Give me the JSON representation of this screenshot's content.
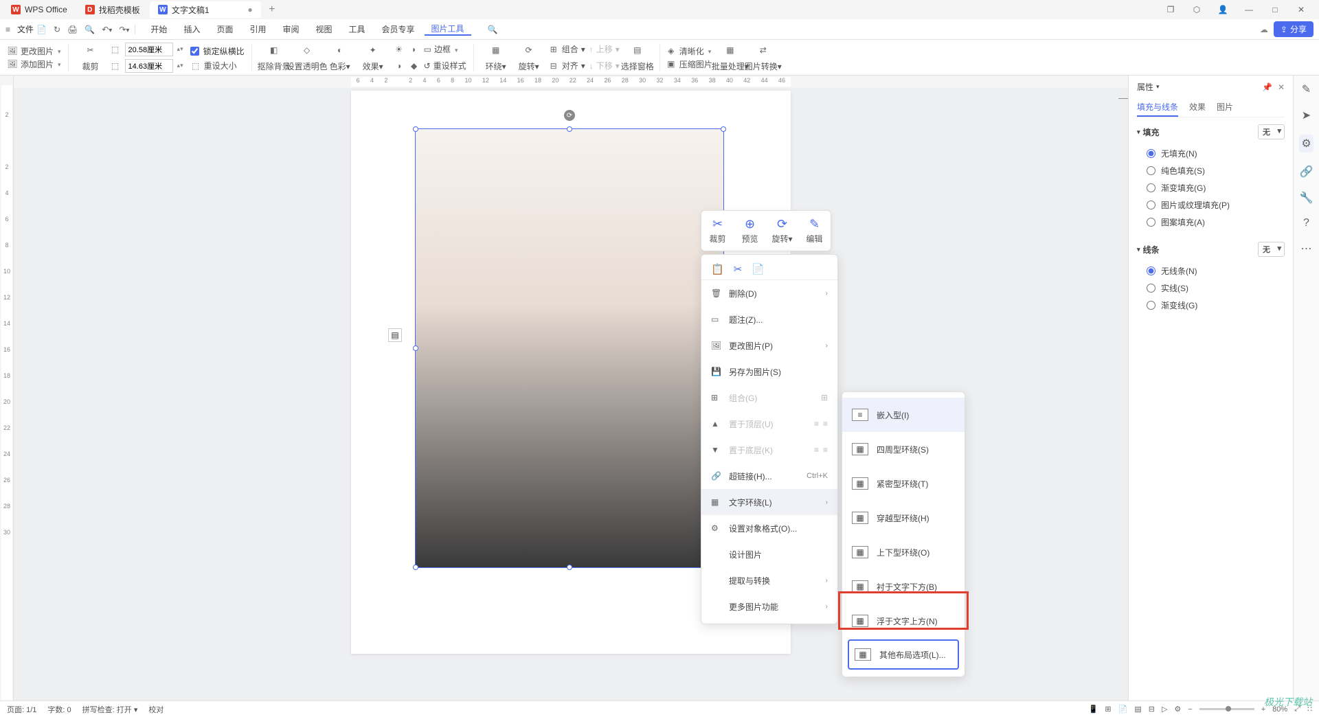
{
  "title_tabs": [
    {
      "label": "WPS Office",
      "logo": "W",
      "active": false
    },
    {
      "label": "找稻壳模板",
      "logo": "D",
      "active": false
    },
    {
      "label": "文字文稿1",
      "logo": "W",
      "active": true
    }
  ],
  "win_ctrls": {
    "multi": "❐",
    "cube": "⬡",
    "avatar": "👤",
    "min": "—",
    "max": "□",
    "close": "✕"
  },
  "menu": {
    "file": "文件",
    "items": [
      "开始",
      "插入",
      "页面",
      "引用",
      "审阅",
      "视图",
      "工具",
      "会员专享",
      "图片工具"
    ],
    "active": "图片工具",
    "cloud_icon": "☁",
    "share": "分享"
  },
  "ribbon": {
    "change_image": "更改图片",
    "add_image": "添加图片",
    "crop": "裁剪",
    "width": "20.58厘米",
    "height": "14.63厘米",
    "lock_ratio": "锁定纵横比",
    "reset_size": "重设大小",
    "remove_bg": "抠除背景",
    "set_trans": "设置透明色",
    "color": "色彩",
    "effect": "效果",
    "border": "边框",
    "reset_style": "重设样式",
    "wrap": "环绕",
    "rotate": "旋转",
    "align": "对齐",
    "combine": "组合",
    "move_up": "上移",
    "move_down": "下移",
    "sel_pane": "选择窗格",
    "sharpen": "清晰化",
    "compress": "压缩图片",
    "batch": "批量处理",
    "convert": "图片转换"
  },
  "ruler_h": [
    "6",
    "4",
    "2",
    "",
    "2",
    "4",
    "6",
    "8",
    "10",
    "12",
    "14",
    "16",
    "18",
    "20",
    "22",
    "24",
    "26",
    "28",
    "30",
    "32",
    "34",
    "36",
    "38",
    "40",
    "42",
    "44",
    "46"
  ],
  "ruler_v": [
    "",
    "2",
    "",
    "2",
    "4",
    "6",
    "8",
    "10",
    "12",
    "14",
    "16",
    "18",
    "20",
    "22",
    "24",
    "26",
    "28",
    "30"
  ],
  "float_tb": {
    "crop": "裁剪",
    "preview": "预览",
    "rotate": "旋转",
    "edit": "编辑"
  },
  "context_menu": {
    "delete": "删除(D)",
    "caption": "题注(Z)...",
    "change_img": "更改图片(P)",
    "save_as": "另存为图片(S)",
    "combine": "组合(G)",
    "top": "置于顶层(U)",
    "bottom": "置于底层(K)",
    "hyperlink": "超链接(H)...",
    "hyperlink_sc": "Ctrl+K",
    "text_wrap": "文字环绕(L)",
    "obj_format": "设置对象格式(O)...",
    "design": "设计图片",
    "extract": "提取与转换",
    "more": "更多图片功能"
  },
  "submenu": {
    "inline": "嵌入型(I)",
    "square": "四周型环绕(S)",
    "tight": "紧密型环绕(T)",
    "through": "穿越型环绕(H)",
    "topbottom": "上下型环绕(O)",
    "behind": "衬于文字下方(B)",
    "front": "浮于文字上方(N)",
    "other": "其他布局选项(L)..."
  },
  "panel": {
    "title": "属性",
    "tabs": [
      "填充与线条",
      "效果",
      "图片"
    ],
    "tab_active": "填充与线条",
    "fill_head": "填充",
    "fill_select": "无",
    "fill_opts": [
      "无填充(N)",
      "纯色填充(S)",
      "渐变填充(G)",
      "图片或纹理填充(P)",
      "图案填充(A)"
    ],
    "fill_checked": "无填充(N)",
    "line_head": "线条",
    "line_select": "无",
    "line_opts": [
      "无线条(N)",
      "实线(S)",
      "渐变线(G)"
    ],
    "line_checked": "无线条(N)"
  },
  "status": {
    "page": "页面: 1/1",
    "words": "字数: 0",
    "spell": "拼写检查: 打开",
    "proof": "校对",
    "zoom": "80%"
  },
  "watermark": "极光下载站"
}
